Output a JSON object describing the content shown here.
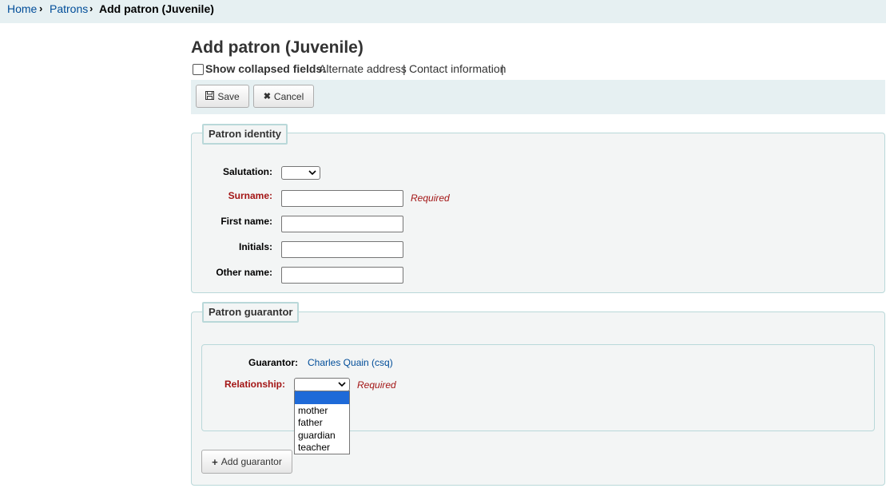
{
  "breadcrumb": {
    "home": "Home",
    "patrons": "Patrons",
    "current": "Add patron (Juvenile)",
    "separator": "›"
  },
  "page": {
    "title": "Add patron (Juvenile)"
  },
  "collapse": {
    "label": "Show collapsed fields:",
    "links": [
      "Alternate address",
      "Contact information"
    ],
    "separator": "|"
  },
  "toolbar": {
    "save_label": "Save",
    "cancel_label": "Cancel"
  },
  "identity": {
    "legend": "Patron identity",
    "salutation_label": "Salutation:",
    "surname_label": "Surname:",
    "firstname_label": "First name:",
    "initials_label": "Initials:",
    "othername_label": "Other name:",
    "required_text": "Required"
  },
  "guarantor": {
    "legend": "Patron guarantor",
    "guarantor_label": "Guarantor:",
    "guarantor_value": "Charles Quain (csq)",
    "relationship_label": "Relationship:",
    "required_text": "Required",
    "relationship_options": [
      "",
      "mother",
      "father",
      "guardian",
      "teacher"
    ],
    "add_label": "Add guarantor"
  },
  "icons": {
    "save": "save-icon",
    "cancel": "close-icon",
    "add": "plus-icon",
    "chevron": "chevron-down-icon"
  },
  "colors": {
    "link": "#004d99",
    "required": "#a31515",
    "panel_border": "#b9d8d9",
    "panel_bg": "#f3f5f5",
    "header_bg": "#e6f0f2",
    "selected_option": "#1e6ad8"
  }
}
